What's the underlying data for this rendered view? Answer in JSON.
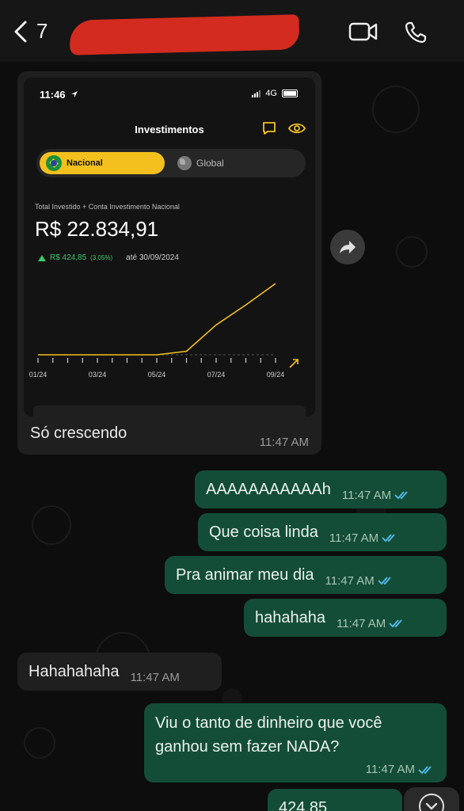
{
  "header": {
    "back_count": "7",
    "contact_name": "",
    "icons": [
      "back-chevron-icon",
      "video-call-icon",
      "phone-call-icon"
    ]
  },
  "image_message": {
    "screenshot": {
      "status_time": "11:46",
      "network": "4G",
      "title": "Investimentos",
      "tabs": [
        {
          "label": "Nacional",
          "active": true
        },
        {
          "label": "Global",
          "active": false
        }
      ],
      "total_label": "Total Investido + Conta Investimento Nacional",
      "total_value": "R$ 22.834,91",
      "gain_amount": "R$ 424,85",
      "gain_percent": "(3,05%)",
      "gain_date": "até 30/09/2024",
      "accent_color": "#f4c01e"
    },
    "caption": "Só crescendo",
    "time": "11:47 AM"
  },
  "chart_data": {
    "type": "line",
    "title": "",
    "xlabel": "",
    "ylabel": "",
    "x_tick_labels": [
      "01/24",
      "03/24",
      "05/24",
      "07/24",
      "09/24"
    ],
    "x": [
      "01/24",
      "02/24",
      "03/24",
      "04/24",
      "05/24",
      "06/24",
      "07/24",
      "08/24",
      "09/24"
    ],
    "series": [
      {
        "values": [
          0,
          0,
          0,
          0,
          0,
          0.05,
          0.42,
          0.7,
          1.0
        ]
      }
    ],
    "grid": false,
    "line_color": "#f4c01e"
  },
  "messages": [
    {
      "dir": "out",
      "text": "AAAAAAAAAAAh",
      "time": "11:47 AM"
    },
    {
      "dir": "out",
      "text": "Que coisa linda",
      "time": "11:47 AM"
    },
    {
      "dir": "out",
      "text": "Pra animar meu dia",
      "time": "11:47 AM"
    },
    {
      "dir": "out",
      "text": "hahahaha",
      "time": "11:47 AM"
    },
    {
      "dir": "in",
      "text": "Hahahahaha",
      "time": "11:47 AM"
    },
    {
      "dir": "out",
      "text": "Viu o tanto de dinheiro que você ganhou sem fazer NADA?",
      "time": "11:47 AM"
    },
    {
      "dir": "out",
      "text": "424,85",
      "time": ""
    }
  ]
}
